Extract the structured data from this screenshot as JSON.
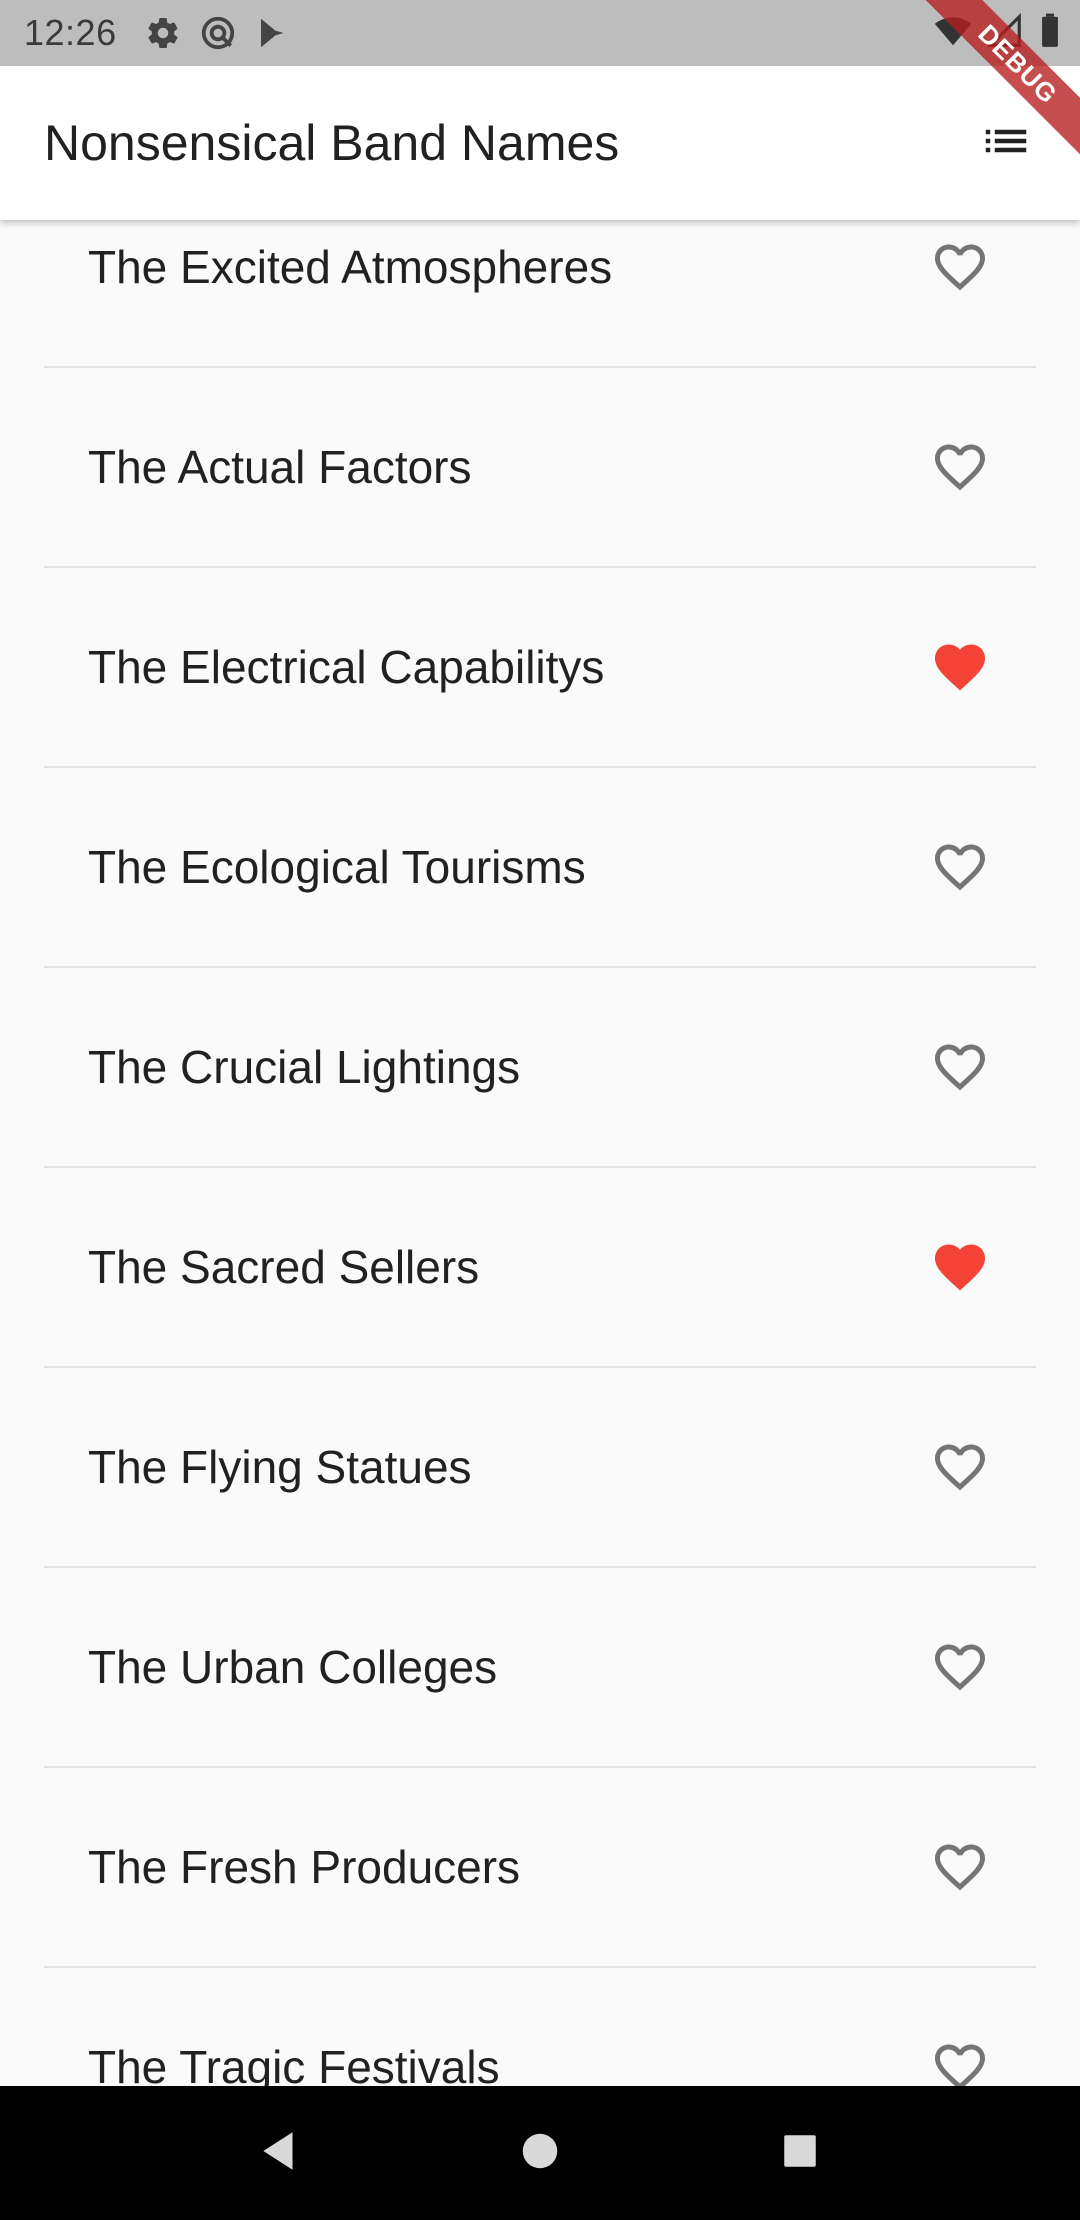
{
  "status_bar": {
    "time": "12:26",
    "left_icons": [
      "settings-icon",
      "vpn-icon",
      "play-store-icon"
    ],
    "right_icons": [
      "wifi-icon",
      "signal-icon",
      "battery-icon"
    ]
  },
  "app_bar": {
    "title": "Nonsensical Band Names",
    "action_icon": "list-icon"
  },
  "debug_banner": "DEBUG",
  "list": {
    "items": [
      {
        "name": "The Excited Atmospheres",
        "favorited": false
      },
      {
        "name": "The Actual Factors",
        "favorited": false
      },
      {
        "name": "The Electrical Capabilitys",
        "favorited": true
      },
      {
        "name": "The Ecological Tourisms",
        "favorited": false
      },
      {
        "name": "The Crucial Lightings",
        "favorited": false
      },
      {
        "name": "The Sacred Sellers",
        "favorited": true
      },
      {
        "name": "The Flying Statues",
        "favorited": false
      },
      {
        "name": "The Urban Colleges",
        "favorited": false
      },
      {
        "name": "The Fresh Producers",
        "favorited": false
      },
      {
        "name": "The Tragic Festivals",
        "favorited": false
      }
    ]
  },
  "nav_bar": {
    "buttons": [
      "back-icon",
      "home-icon",
      "recents-icon"
    ]
  },
  "colors": {
    "favorite": "#f44336",
    "unfavorite": "#757575",
    "status_bar": "#bdbdbd",
    "background": "#fafafa"
  }
}
